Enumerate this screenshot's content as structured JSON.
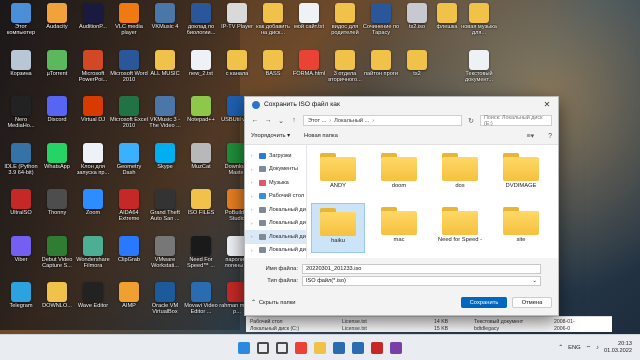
{
  "desktop_icons": [
    {
      "label": "Этот компьютер",
      "color": "#4a8fd8",
      "col": 0,
      "row": 0
    },
    {
      "label": "Audacity",
      "color": "#f2a23a",
      "col": 1,
      "row": 0
    },
    {
      "label": "AuditionP...",
      "color": "#1a1a40",
      "col": 2,
      "row": 0
    },
    {
      "label": "VLC media player",
      "color": "#f07a12",
      "col": 3,
      "row": 0
    },
    {
      "label": "VKMusic 4",
      "color": "#4a76a8",
      "col": 4,
      "row": 0
    },
    {
      "label": "доклад по биологии...",
      "color": "#2b579a",
      "col": 5,
      "row": 0
    },
    {
      "label": "IP-TV Player",
      "color": "#d9d9d9",
      "col": 6,
      "row": 0
    },
    {
      "label": "как добавить на диск...",
      "color": "#f0c24a",
      "col": 7,
      "row": 0
    },
    {
      "label": "мой сайт.txt",
      "color": "#eef1f5",
      "col": 8,
      "row": 0
    },
    {
      "label": "видос для родителей",
      "color": "#f0c24a",
      "col": 9,
      "row": 0
    },
    {
      "label": "Сочинение по Тарасу",
      "color": "#2b579a",
      "col": 10,
      "row": 0
    },
    {
      "label": "ts2.iso",
      "color": "#c8c8d0",
      "col": 11,
      "row": 0
    },
    {
      "label": "флешка",
      "color": "#f0c24a",
      "col": 12,
      "row": 0
    },
    {
      "label": "новая музыка для...",
      "color": "#f0c24a",
      "col": 13,
      "row": 0
    },
    {
      "label": "Корзина",
      "color": "#b9c6d6",
      "col": 0,
      "row": 1
    },
    {
      "label": "µTorrent",
      "color": "#5cb85c",
      "col": 1,
      "row": 1
    },
    {
      "label": "Microsoft PowerPoi...",
      "color": "#d24726",
      "col": 2,
      "row": 1
    },
    {
      "label": "Microsoft Word 2010",
      "color": "#2b579a",
      "col": 3,
      "row": 1
    },
    {
      "label": "ALL MUSIC",
      "color": "#f0c24a",
      "col": 4,
      "row": 1
    },
    {
      "label": "new_2.txt",
      "color": "#eef1f5",
      "col": 5,
      "row": 1
    },
    {
      "label": "с канала",
      "color": "#f0c24a",
      "col": 6,
      "row": 1
    },
    {
      "label": "BASS",
      "color": "#f0c24a",
      "col": 7,
      "row": 1
    },
    {
      "label": "FORMA.html",
      "color": "#ea4335",
      "col": 8,
      "row": 1
    },
    {
      "label": "3 отдела вторичного...",
      "color": "#f0c24a",
      "col": 9,
      "row": 1
    },
    {
      "label": "пайтон проги",
      "color": "#f0c24a",
      "col": 10,
      "row": 1
    },
    {
      "label": "ts2",
      "color": "#f0c24a",
      "col": 11,
      "row": 1
    },
    {
      "label": "Текстовый документ...",
      "color": "#eef1f5",
      "col": 13,
      "row": 1
    },
    {
      "label": "Nero MediaHo...",
      "color": "#222",
      "col": 0,
      "row": 2
    },
    {
      "label": "Discord",
      "color": "#5865f2",
      "col": 1,
      "row": 2
    },
    {
      "label": "Virtual DJ",
      "color": "#d83b01",
      "col": 2,
      "row": 2
    },
    {
      "label": "Microsoft Excel 2010",
      "color": "#217346",
      "col": 3,
      "row": 2
    },
    {
      "label": "VKMusic 3 - The Video ...",
      "color": "#4a76a8",
      "col": 4,
      "row": 2
    },
    {
      "label": "Notepad++",
      "color": "#8fc74a",
      "col": 5,
      "row": 2
    },
    {
      "label": "USBUtil v2...",
      "color": "#1e5fb0",
      "col": 6,
      "row": 2
    },
    {
      "label": "IDLE (Python 3.9 64-bit)",
      "color": "#3572a5",
      "col": 0,
      "row": 3
    },
    {
      "label": "WhatsApp",
      "color": "#25d366",
      "col": 1,
      "row": 3
    },
    {
      "label": "Клон для запуска пр...",
      "color": "#eef1f5",
      "col": 2,
      "row": 3
    },
    {
      "label": "Geometry Dash",
      "color": "#3ab0ff",
      "col": 3,
      "row": 3
    },
    {
      "label": "Skype",
      "color": "#00aff0",
      "col": 4,
      "row": 3
    },
    {
      "label": "MuzCat",
      "color": "#b8b8b8",
      "col": 5,
      "row": 3
    },
    {
      "label": "Download Master",
      "color": "#1e8f3a",
      "col": 6,
      "row": 3
    },
    {
      "label": "UltraISO",
      "color": "#c62828",
      "col": 0,
      "row": 4
    },
    {
      "label": "Thonny",
      "color": "#4d4d4d",
      "col": 1,
      "row": 4
    },
    {
      "label": "Zoom",
      "color": "#2d8cff",
      "col": 2,
      "row": 4
    },
    {
      "label": "AIDA64 Extreme",
      "color": "#c62828",
      "col": 3,
      "row": 4
    },
    {
      "label": "Grand Theft Auto San ...",
      "color": "#333",
      "col": 4,
      "row": 4
    },
    {
      "label": "ISO FILES",
      "color": "#f0c24a",
      "col": 5,
      "row": 4
    },
    {
      "label": "PoBuilder Studio",
      "color": "#e67e22",
      "col": 6,
      "row": 4
    },
    {
      "label": "Viber",
      "color": "#7360f2",
      "col": 0,
      "row": 5
    },
    {
      "label": "Debut Video Capture S...",
      "color": "#2e7d32",
      "col": 1,
      "row": 5
    },
    {
      "label": "Wondershare Filmora",
      "color": "#4caf93",
      "col": 2,
      "row": 5
    },
    {
      "label": "ClipGrab",
      "color": "#2979ff",
      "col": 3,
      "row": 5
    },
    {
      "label": "VMware Workstati...",
      "color": "#777",
      "col": 4,
      "row": 5
    },
    {
      "label": "Need For Speed™ ...",
      "color": "#1a1a1a",
      "col": 5,
      "row": 5
    },
    {
      "label": "пароли и логины ...",
      "color": "#eef1f5",
      "col": 6,
      "row": 5
    },
    {
      "label": "Telegram",
      "color": "#2aa3e0",
      "col": 0,
      "row": 6
    },
    {
      "label": "DOWNLO...",
      "color": "#f0c24a",
      "col": 1,
      "row": 6
    },
    {
      "label": "Wave Editor",
      "color": "#222",
      "col": 2,
      "row": 6
    },
    {
      "label": "AIMP",
      "color": "#f0a030",
      "col": 3,
      "row": 6
    },
    {
      "label": "Oracle VM VirtualBox",
      "color": "#1d5a9c",
      "col": 4,
      "row": 6
    },
    {
      "label": "Movavi Video Editor ...",
      "color": "#2b6cb0",
      "col": 5,
      "row": 6
    },
    {
      "label": "rahman minus p...",
      "color": "#c62828",
      "col": 6,
      "row": 6
    }
  ],
  "dialog": {
    "title": "Сохранить ISO файл как",
    "close": "✕",
    "nav_back": "←",
    "nav_forward": "→",
    "nav_dropdown": "⌄",
    "nav_up": "↑",
    "address": [
      "Этот ...",
      "Локальный ...",
      "›"
    ],
    "address_sep": "›",
    "refresh": "↻",
    "search_placeholder": "Поиск: Локальный диск (E:)",
    "organize": "Упорядочить ▾",
    "new_folder": "Новая папка",
    "view_icon": "≡▾",
    "help_icon": "?",
    "nav_items": [
      {
        "label": "Загрузки",
        "color": "#2d7ad6"
      },
      {
        "label": "Документы",
        "color": "#7a8c9e"
      },
      {
        "label": "Музыка",
        "color": "#e0566b"
      },
      {
        "label": "Рабочий стол",
        "color": "#3b8ed8"
      },
      {
        "label": "Локальный ди",
        "color": "#7f8a96"
      },
      {
        "label": "Локальный ди",
        "color": "#7f8a96"
      },
      {
        "label": "Локальный ди",
        "color": "#7f8a96"
      },
      {
        "label": "Локальный ди",
        "color": "#7f8a96"
      }
    ],
    "folders": [
      "ANDY",
      "doom",
      "dos",
      "DVDIMAGE",
      "haiku",
      "mac",
      "Need for Speed -",
      "site"
    ],
    "file_name_label": "Имя файла:",
    "file_name_value": "20220301_201233.iso",
    "file_type_label": "Тип файла:",
    "file_type_value": "ISO файл(*.iso)",
    "hide_folders": "Скрыть папки",
    "save": "Сохранить",
    "cancel": "Отмена"
  },
  "background_explorer": {
    "rows": [
      [
        "Рабочий стол",
        "License.txt",
        "14 KB",
        "Текстовый документ",
        "2008-01-"
      ],
      [
        "Локальный диск (C:)",
        "License.txt",
        "15 KB",
        "bdtdlegacy",
        "2006-0"
      ],
      [
        "",
        "",
        "16 KB",
        "bdtdlegacy",
        "2006-0"
      ]
    ]
  },
  "taskbar": {
    "lang": "ENG",
    "time": "20:13",
    "date": "01.03.2022",
    "icons": [
      {
        "name": "start-icon",
        "color": "#2b8ae0"
      },
      {
        "name": "search-icon",
        "color": "#4a4a4a"
      },
      {
        "name": "task-view-icon",
        "color": "#4a4a4a"
      },
      {
        "name": "chrome-icon",
        "color": "#ea4335"
      },
      {
        "name": "file-explorer-icon",
        "color": "#f0c24a"
      },
      {
        "name": "store-icon",
        "color": "#2b6cb0"
      },
      {
        "name": "mail-icon",
        "color": "#2b6cb0"
      },
      {
        "name": "ultraiso-icon",
        "color": "#c62828"
      },
      {
        "name": "app-icon",
        "color": "#7a3ea8"
      }
    ]
  }
}
